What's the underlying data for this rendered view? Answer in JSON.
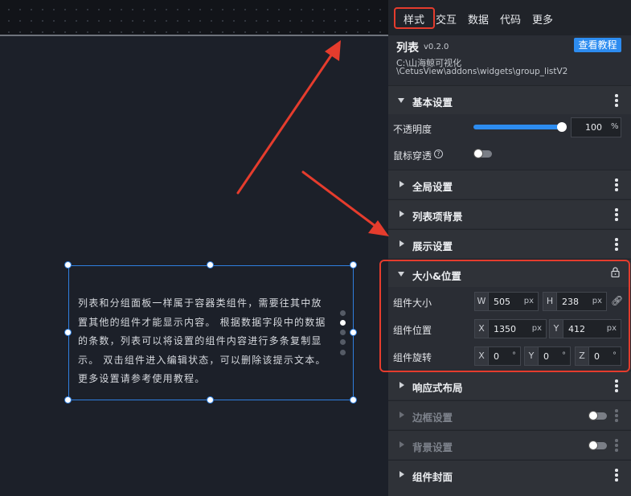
{
  "tabs": [
    "样式",
    "交互",
    "数据",
    "代码",
    "更多"
  ],
  "widget": {
    "title": "列表",
    "version": "v0.2.0",
    "tutorial_button": "查看教程",
    "path_line1": "C:\\山海鲸可视化",
    "path_line2": "\\CetusView\\addons\\widgets\\group_listV2"
  },
  "sections": {
    "basic": "基本设置",
    "global": "全局设置",
    "item_bg": "列表项背景",
    "display": "展示设置",
    "size_pos": "大小&位置",
    "responsive": "响应式布局",
    "border": "边框设置",
    "background": "背景设置",
    "cover": "组件封面"
  },
  "basic": {
    "opacity_label": "不透明度",
    "opacity_value": "100",
    "opacity_unit": "%",
    "opacity_fraction": 1.0,
    "mouse_through_label": "鼠标穿透",
    "help_glyph": "?"
  },
  "size": {
    "size_label": "组件大小",
    "w_prefix": "W",
    "w_value": "505",
    "w_unit": "px",
    "h_prefix": "H",
    "h_value": "238",
    "h_unit": "px",
    "pos_label": "组件位置",
    "x_prefix": "X",
    "x_value": "1350",
    "x_unit": "px",
    "y_prefix": "Y",
    "y_value": "412",
    "y_unit": "px",
    "rot_label": "组件旋转",
    "rx_prefix": "X",
    "rx_value": "0",
    "rx_unit": "°",
    "ry_prefix": "Y",
    "ry_value": "0",
    "ry_unit": "°",
    "rz_prefix": "Z",
    "rz_value": "0",
    "rz_unit": "°"
  },
  "canvas": {
    "hint_text": "列表和分组面板一样属于容器类组件，需要往其中放\n置其他的组件才能显示内容。 根据数据字段中的数据\n的条数，列表可以将设置的组件内容进行多条复制显\n示。 双击组件进入编辑状态，可以删除该提示文本。\n更多设置请参考使用教程。"
  },
  "icons": {
    "link": "link-icon",
    "lock": "lock-icon",
    "kebab": "more-vertical-icon",
    "help": "help-circle-icon"
  },
  "colors": {
    "accent": "#2d8cf0",
    "annotation": "#e53c2d",
    "panel": "#2a2d34",
    "canvas": "#1c2029"
  }
}
